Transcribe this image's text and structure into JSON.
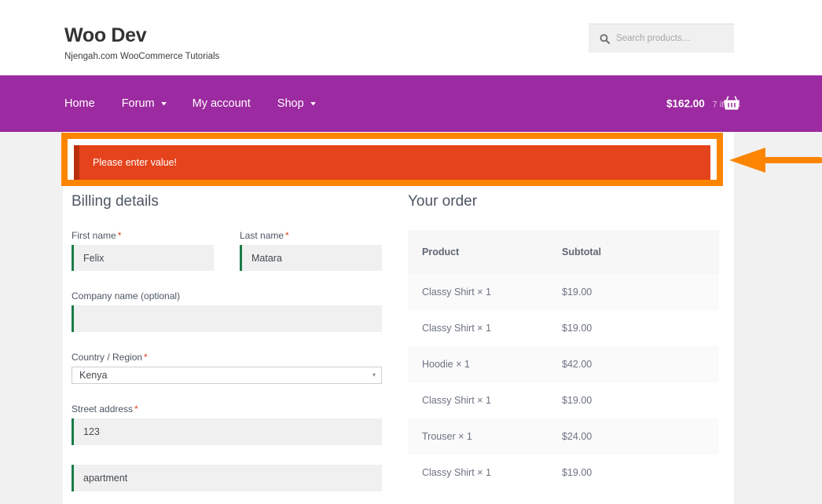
{
  "header": {
    "brand_title": "Woo Dev",
    "brand_tagline": "Njengah.com WooCommerce Tutorials",
    "search_placeholder": "Search products…",
    "search_value": "",
    "search_icon": "search-icon"
  },
  "nav": {
    "background_color": "#9c2aa0",
    "items": [
      {
        "label": "Home",
        "has_dropdown": false
      },
      {
        "label": "Forum",
        "has_dropdown": true
      },
      {
        "label": "My account",
        "has_dropdown": false
      },
      {
        "label": "Shop",
        "has_dropdown": true
      }
    ],
    "caret_glyph": "▾",
    "cart": {
      "total": "$162.00",
      "count": "7 items",
      "icon": "shopping-basket-icon"
    }
  },
  "notice": {
    "message": "Please enter value!",
    "background_color": "#e4431c",
    "accent_color": "#b9300f",
    "highlight_color": "#fb8500",
    "annotation_arrow": "left-pointing-arrow"
  },
  "billing": {
    "title": "Billing details",
    "fields": [
      {
        "label": "First name",
        "required": true,
        "value": "Felix",
        "placeholder": ""
      },
      {
        "label": "Last name",
        "required": true,
        "value": "Matara",
        "placeholder": ""
      },
      {
        "label": "Company name (optional)",
        "required": false,
        "value": "",
        "placeholder": ""
      },
      {
        "label": "Country / Region",
        "required": true,
        "value": "Kenya",
        "type": "select"
      },
      {
        "label": "Street address",
        "required": true,
        "value": "123",
        "placeholder": ""
      },
      {
        "label": "",
        "required": false,
        "value": "apartment",
        "placeholder": ""
      }
    ],
    "required_marker": "*",
    "select_caret": "▾"
  },
  "order": {
    "title": "Your order",
    "columns": [
      "Product",
      "Subtotal"
    ],
    "rows": [
      {
        "product": "Classy Shirt",
        "qty": "× 1",
        "subtotal": "$19.00"
      },
      {
        "product": "Classy Shirt",
        "qty": "× 1",
        "subtotal": "$19.00"
      },
      {
        "product": "Hoodie",
        "qty": "× 1",
        "subtotal": "$42.00"
      },
      {
        "product": "Classy Shirt",
        "qty": "× 1",
        "subtotal": "$19.00"
      },
      {
        "product": "Trouser",
        "qty": "× 1",
        "subtotal": "$24.00"
      },
      {
        "product": "Classy Shirt",
        "qty": "× 1",
        "subtotal": "$19.00"
      }
    ]
  }
}
